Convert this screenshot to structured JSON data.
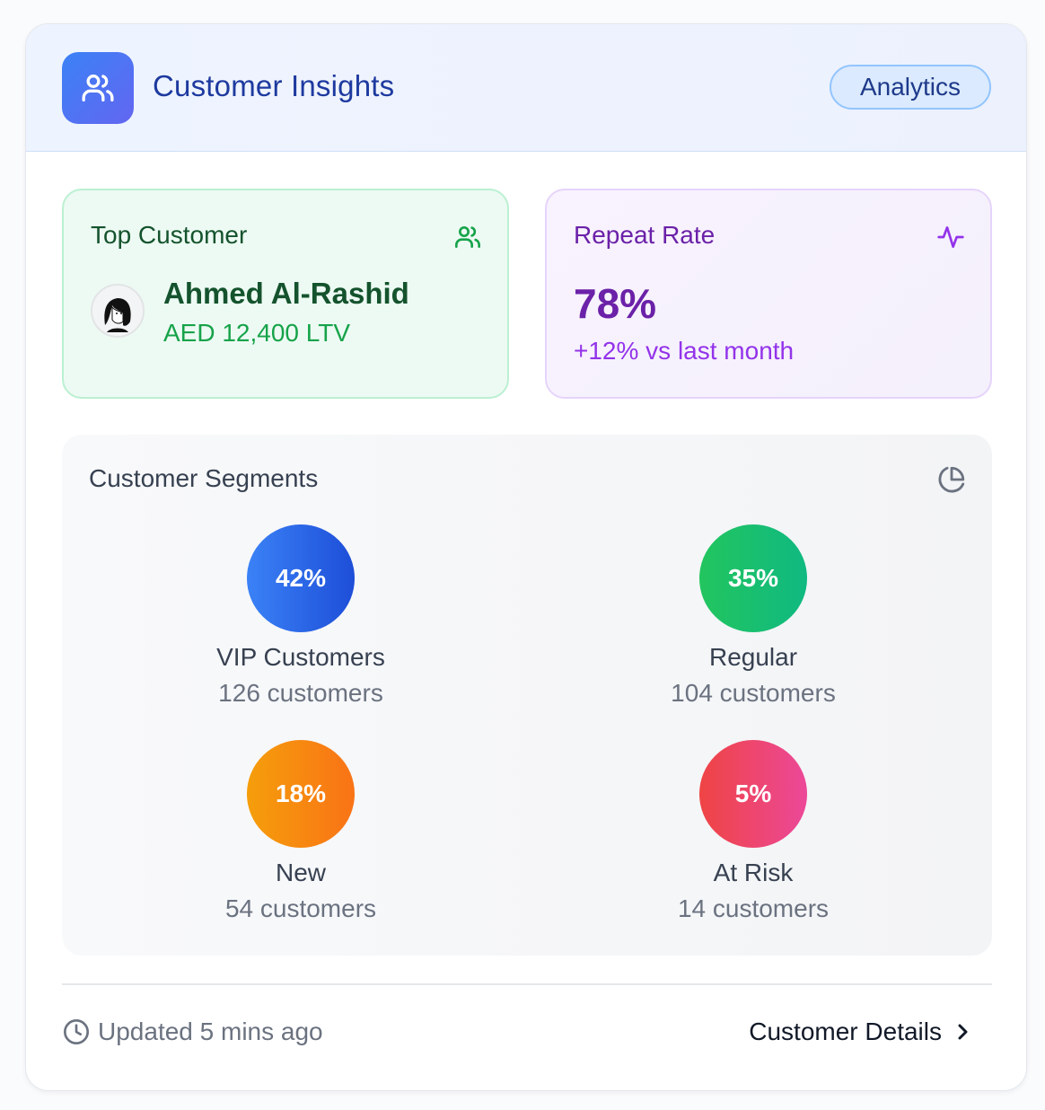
{
  "header": {
    "title": "Customer Insights",
    "badge": "Analytics",
    "icon": "users-icon"
  },
  "top_customer": {
    "label": "Top Customer",
    "icon": "users-icon",
    "name": "Ahmed Al-Rashid",
    "ltv": "AED 12,400 LTV"
  },
  "repeat_rate": {
    "label": "Repeat Rate",
    "icon": "activity-icon",
    "value": "78%",
    "change": "+12% vs last month"
  },
  "segments": {
    "title": "Customer Segments",
    "icon": "pie-chart-icon",
    "items": [
      {
        "percent": "42%",
        "name": "VIP Customers",
        "count": "126 customers",
        "color_from": "#3b82f6",
        "color_to": "#1d4ed8"
      },
      {
        "percent": "35%",
        "name": "Regular",
        "count": "104 customers",
        "color_from": "#22c55e",
        "color_to": "#10b981"
      },
      {
        "percent": "18%",
        "name": "New",
        "count": "54 customers",
        "color_from": "#f59e0b",
        "color_to": "#f97316"
      },
      {
        "percent": "5%",
        "name": "At Risk",
        "count": "14 customers",
        "color_from": "#ef4444",
        "color_to": "#ec4899"
      }
    ]
  },
  "footer": {
    "updated": "Updated 5 mins ago",
    "details_link": "Customer Details",
    "clock_icon": "clock-icon",
    "chevron_icon": "chevron-right-icon"
  },
  "colors": {
    "accent": "#1e3a9f",
    "green": "#16a34a",
    "purple": "#6b21a8"
  }
}
